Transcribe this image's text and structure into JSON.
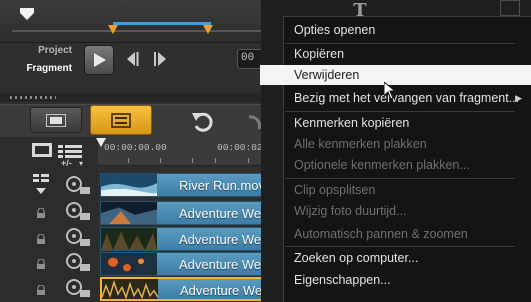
{
  "editor": {
    "mode_labels": {
      "project": "Project",
      "fragment": "Fragment"
    },
    "timecode_stub": "00",
    "time_ruler": {
      "start": "00:00:00.00",
      "next": "00:00:02."
    },
    "tracks_control": "+/-",
    "clips": [
      {
        "name": "River Run.mov",
        "selected": false
      },
      {
        "name": "Adventure We",
        "selected": false
      },
      {
        "name": "Adventure We",
        "selected": false
      },
      {
        "name": "Adventure We",
        "selected": false
      },
      {
        "name": "Adventure We",
        "selected": true
      }
    ]
  },
  "context_menu": {
    "items": [
      {
        "label": "Opties openen",
        "enabled": true
      },
      {
        "label": "Kopiëren",
        "enabled": true
      },
      {
        "label": "Verwijderen",
        "enabled": true,
        "highlighted": true
      },
      {
        "label": "Bezig met het vervangen van fragment...",
        "enabled": true,
        "submenu": true
      },
      {
        "label": "Kenmerken kopiëren",
        "enabled": true
      },
      {
        "label": "Alle kenmerken plakken",
        "enabled": false
      },
      {
        "label": "Optionele kenmerken plakken...",
        "enabled": false
      },
      {
        "label": "Clip opsplitsen",
        "enabled": false
      },
      {
        "label": "Wijzig foto duurtijd...",
        "enabled": false
      },
      {
        "label": "Automatisch pannen & zoomen",
        "enabled": false
      },
      {
        "label": "Zoeken op computer...",
        "enabled": true
      },
      {
        "label": "Eigenschappen...",
        "enabled": true
      }
    ]
  },
  "colors": {
    "accent_orange": "#f3b335",
    "trim_blue": "#3ba3e3",
    "clip_blue": "#4a8bb3"
  }
}
